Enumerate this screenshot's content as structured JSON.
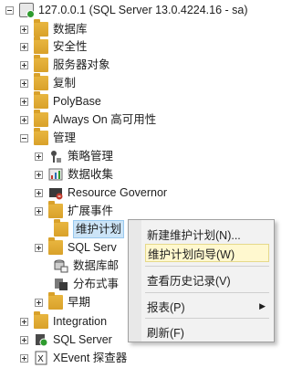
{
  "server": {
    "label": "127.0.0.1 (SQL Server 13.0.4224.16 - sa)"
  },
  "tree": [
    {
      "label": "数据库"
    },
    {
      "label": "安全性"
    },
    {
      "label": "服务器对象"
    },
    {
      "label": "复制"
    },
    {
      "label": "PolyBase"
    },
    {
      "label": "Always On 高可用性"
    },
    {
      "label": "管理"
    },
    {
      "label": "策略管理"
    },
    {
      "label": "数据收集"
    },
    {
      "label": "Resource Governor"
    },
    {
      "label": "扩展事件"
    },
    {
      "label": "维护计划"
    },
    {
      "label": "SQL Serv"
    },
    {
      "label": "数据库邮"
    },
    {
      "label": "分布式事"
    },
    {
      "label": "早期"
    },
    {
      "label": "Integration"
    },
    {
      "label": "SQL Server"
    },
    {
      "label": "XEvent 探查器"
    }
  ],
  "context_menu": [
    {
      "label": "新建维护计划(N)..."
    },
    {
      "label": "维护计划向导(W)"
    },
    {
      "label": "查看历史记录(V)"
    },
    {
      "label": "报表(P)"
    },
    {
      "label": "刷新(F)"
    }
  ]
}
